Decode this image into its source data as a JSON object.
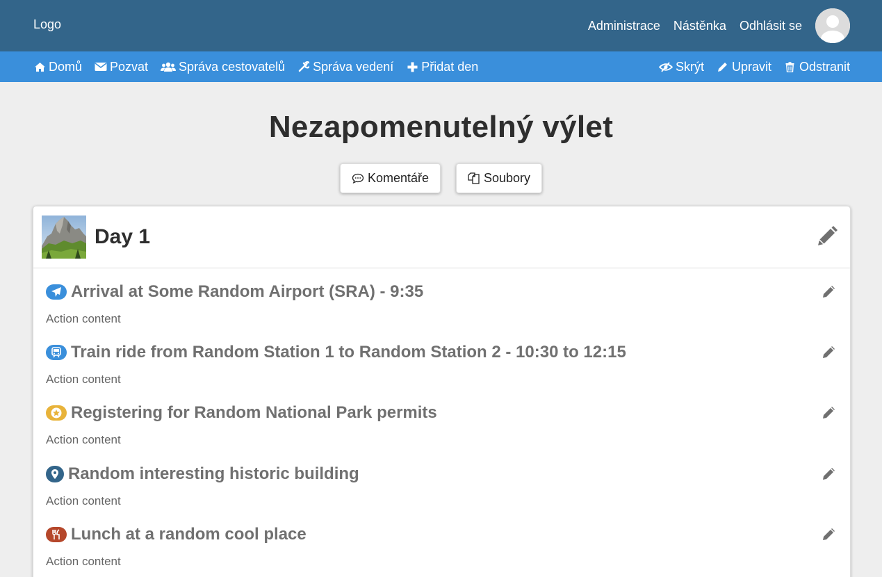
{
  "topbar": {
    "logo": "Logo",
    "links": [
      "Administrace",
      "Nástěnka",
      "Odhlásit se"
    ]
  },
  "subnav": {
    "left": [
      {
        "label": "Domů",
        "icon": "home-icon"
      },
      {
        "label": "Pozvat",
        "icon": "envelope-icon"
      },
      {
        "label": "Správa cestovatelů",
        "icon": "users-icon"
      },
      {
        "label": "Správa vedení",
        "icon": "wrench-icon"
      },
      {
        "label": "Přidat den",
        "icon": "plus-icon"
      }
    ],
    "right": [
      {
        "label": "Skrýt",
        "icon": "eye-slash-icon"
      },
      {
        "label": "Upravit",
        "icon": "pencil-icon"
      },
      {
        "label": "Odstranit",
        "icon": "trash-icon"
      }
    ]
  },
  "page": {
    "title": "Nezapomenutelný výlet",
    "buttons": {
      "comments": "Komentáře",
      "files": "Soubory"
    }
  },
  "day": {
    "title": "Day 1",
    "actions": [
      {
        "title": "Arrival at Some Random Airport (SRA) - 9:35",
        "content": "Action content",
        "icon": "plane-icon",
        "color": "#3a8fdb"
      },
      {
        "title": "Train ride from Random Station 1 to Random Station 2 - 10:30 to 12:15",
        "content": "Action content",
        "icon": "train-icon",
        "color": "#3a8fdb"
      },
      {
        "title": "Registering for Random National Park permits",
        "content": "Action content",
        "icon": "star-icon",
        "color": "#e8b33a"
      },
      {
        "title": "Random interesting historic building",
        "content": "Action content",
        "icon": "map-marker-icon",
        "color": "#33658a"
      },
      {
        "title": "Lunch at a random cool place",
        "content": "Action content",
        "icon": "cutlery-icon",
        "color": "#b5472b"
      }
    ]
  }
}
